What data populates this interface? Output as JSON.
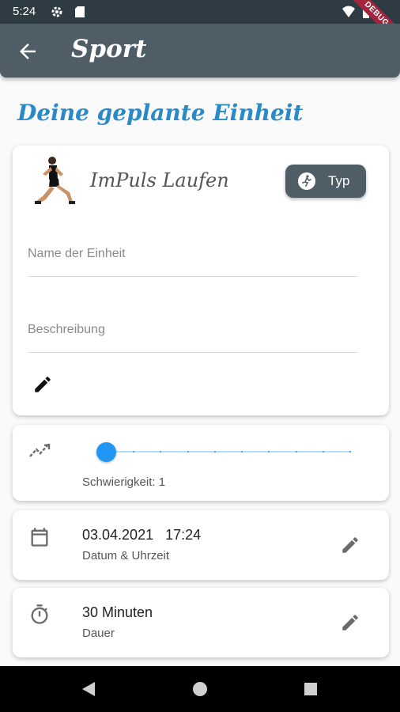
{
  "status_bar": {
    "time": "5:24",
    "debug_label": "DEBUG"
  },
  "app_bar": {
    "title": "Sport",
    "back_icon": "arrow-back-icon"
  },
  "page": {
    "heading": "Deine geplante Einheit"
  },
  "unit_card": {
    "activity_name": "ImPuls Laufen",
    "type_button_label": "Typ",
    "name_placeholder": "Name der Einheit",
    "name_value": "",
    "description_placeholder": "Beschreibung",
    "description_value": ""
  },
  "difficulty": {
    "label": "Schwierigkeit: 1",
    "value": 1,
    "min": 1,
    "max": 10
  },
  "datetime": {
    "date": "03.04.2021",
    "time": "17:24",
    "label": "Datum & Uhrzeit"
  },
  "duration": {
    "value": "30 Minuten",
    "label": "Dauer"
  },
  "colors": {
    "app_bar": "#4f5d66",
    "status_bar": "#2e3b43",
    "heading": "#2b8ac6",
    "slider_accent": "#2196f3",
    "debug_banner": "#a5243b"
  }
}
